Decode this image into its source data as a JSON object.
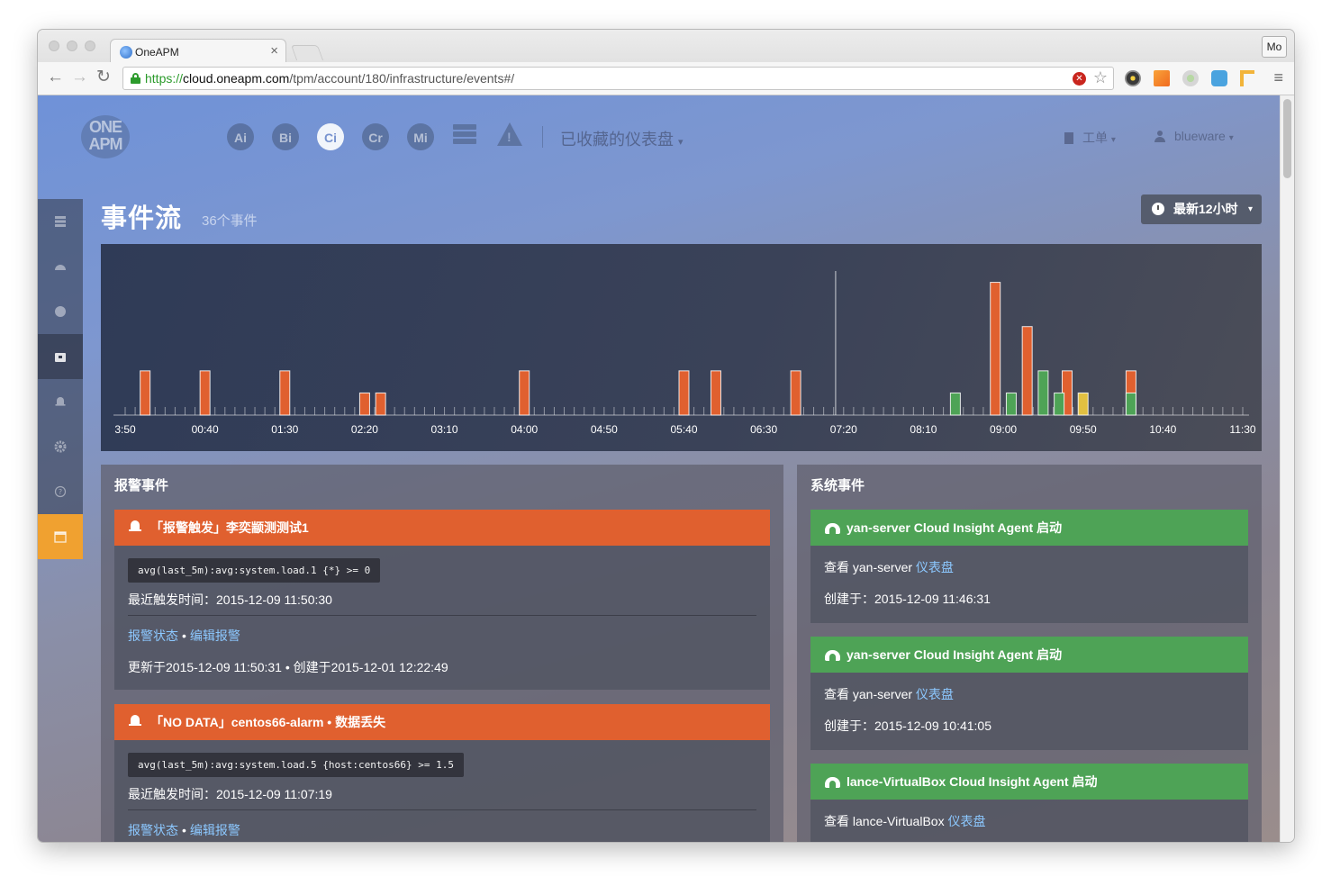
{
  "browser": {
    "tab_title": "OneAPM",
    "tab_close": "×",
    "profile_label": "Mo",
    "url_scheme": "https://",
    "url_host": "cloud.oneapm.com",
    "url_path": "/tpm/account/180/infrastructure/events#/",
    "back_icon": "back-arrow-icon",
    "forward_icon": "forward-arrow-icon",
    "reload_icon": "reload-icon",
    "star_glyph": "☆",
    "menu_glyph": "≡"
  },
  "header": {
    "logo_line1": "ONE",
    "logo_line2": "APM",
    "products": [
      "Ai",
      "Bi",
      "Ci",
      "Cr",
      "Mi"
    ],
    "active_product": "Ci",
    "dashboard_menu": "已收藏的仪表盘",
    "ticket_menu": "工单",
    "user_menu": "blueware",
    "caret": "▾"
  },
  "sidebar": {
    "items": [
      "list-icon",
      "dashboard-icon",
      "circle-icon",
      "events-icon",
      "bell-icon",
      "gear-icon",
      "help-icon",
      "calendar-icon"
    ],
    "active_index": 3,
    "highlight_index": 7,
    "highlight_color": "#f0a130"
  },
  "page": {
    "title": "事件流",
    "event_count": "36个事件",
    "time_range": "最新12小时",
    "time_caret": "▾"
  },
  "chart_data": {
    "type": "bar",
    "x_tick_labels": [
      "3:50",
      "00:40",
      "01:30",
      "02:20",
      "03:10",
      "04:00",
      "04:50",
      "05:40",
      "06:30",
      "07:20",
      "08:10",
      "09:00",
      "09:50",
      "10:40",
      "11:30"
    ],
    "colors": {
      "alert": "#e0602f",
      "system": "#4ea356",
      "warning": "#e2c041"
    },
    "series": [
      {
        "kind": "alert",
        "values": [
          [
            0.25,
            1
          ],
          [
            1.0,
            1
          ],
          [
            2.0,
            1
          ],
          [
            3.0,
            0.5
          ],
          [
            3.2,
            0.5
          ],
          [
            5.0,
            1
          ],
          [
            7.0,
            1
          ],
          [
            7.4,
            1
          ],
          [
            8.4,
            1
          ],
          [
            10.9,
            3
          ],
          [
            11.3,
            2
          ],
          [
            11.8,
            1
          ],
          [
            12.6,
            1
          ]
        ]
      },
      {
        "kind": "system",
        "values": [
          [
            10.4,
            0.5
          ],
          [
            11.1,
            0.5
          ],
          [
            11.5,
            1
          ],
          [
            11.7,
            0.5
          ],
          [
            12.6,
            0.5
          ]
        ]
      },
      {
        "kind": "warning",
        "values": [
          [
            12.0,
            0.5
          ]
        ]
      }
    ],
    "marker_x": 8.9,
    "ylim": [
      0,
      3.5
    ]
  },
  "alert_panel": {
    "title": "报警事件",
    "cards": [
      {
        "title": "「报警触发」李奕颛测测试1",
        "query": "avg(last_5m):avg:system.load.1 {*} >= 0",
        "last_triggered": "最近触发时间：2015-12-09 11:50:30",
        "status_link": "报警状态",
        "separator": "•",
        "edit_link": "编辑报警",
        "updated": "更新于2015-12-09 11:50:31 • 创建于2015-12-01 12:22:49"
      },
      {
        "title": "「NO DATA」centos66-alarm • 数据丢失",
        "query": "avg(last_5m):avg:system.load.5 {host:centos66} >= 1.5",
        "last_triggered": "最近触发时间：2015-12-09 11:07:19",
        "status_link": "报警状态",
        "separator": "•",
        "edit_link": "编辑报警"
      }
    ]
  },
  "system_panel": {
    "title": "系统事件",
    "cards": [
      {
        "title": "yan-server Cloud Insight Agent 启动",
        "view_prefix": "查看 yan-server",
        "view_link": "仪表盘",
        "created": "创建于：2015-12-09 11:46:31"
      },
      {
        "title": "yan-server Cloud Insight Agent 启动",
        "view_prefix": "查看 yan-server",
        "view_link": "仪表盘",
        "created": "创建于：2015-12-09 10:41:05"
      },
      {
        "title": "lance-VirtualBox Cloud Insight Agent 启动",
        "view_prefix": "查看 lance-VirtualBox",
        "view_link": "仪表盘"
      }
    ]
  }
}
